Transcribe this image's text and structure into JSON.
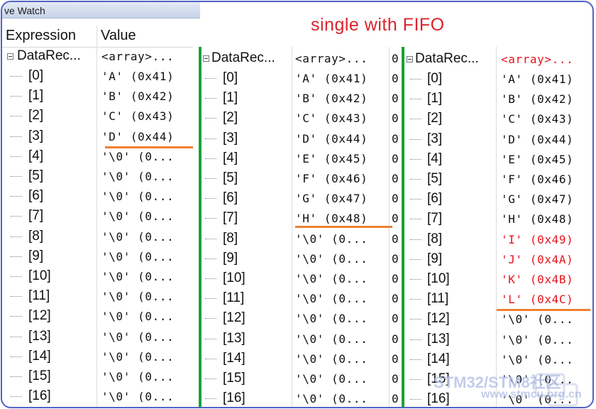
{
  "window": {
    "title": "ve Watch"
  },
  "headers": {
    "expression": "Expression",
    "value": "Value"
  },
  "annotation": "single with FIFO",
  "watermark": {
    "text": "STM32/STM8社区",
    "url": "www.stmcu.org.cn"
  },
  "colors": {
    "separator": "#19a33a",
    "underline": "#f08030",
    "changed_value": "#e8131b",
    "frame": "#4f63c6"
  },
  "panels": [
    {
      "root": {
        "name": "DataRec...",
        "value": "<array>..."
      },
      "rows": [
        {
          "index": "[0]",
          "value": "'A'  (0x41)"
        },
        {
          "index": "[1]",
          "value": "'B'  (0x42)"
        },
        {
          "index": "[2]",
          "value": "'C'  (0x43)"
        },
        {
          "index": "[3]",
          "value": "'D'  (0x44)"
        },
        {
          "index": "[4]",
          "value": "'\\0'  (0..."
        },
        {
          "index": "[5]",
          "value": "'\\0'  (0..."
        },
        {
          "index": "[6]",
          "value": "'\\0'  (0..."
        },
        {
          "index": "[7]",
          "value": "'\\0'  (0..."
        },
        {
          "index": "[8]",
          "value": "'\\0'  (0..."
        },
        {
          "index": "[9]",
          "value": "'\\0'  (0..."
        },
        {
          "index": "[10]",
          "value": "'\\0'  (0..."
        },
        {
          "index": "[11]",
          "value": "'\\0'  (0..."
        },
        {
          "index": "[12]",
          "value": "'\\0'  (0..."
        },
        {
          "index": "[13]",
          "value": "'\\0'  (0..."
        },
        {
          "index": "[14]",
          "value": "'\\0'  (0..."
        },
        {
          "index": "[15]",
          "value": "'\\0'  (0..."
        },
        {
          "index": "[16]",
          "value": "'\\0'  (0..."
        }
      ]
    },
    {
      "root": {
        "name": "DataRec...",
        "value": "<array>...",
        "extra": "0"
      },
      "rows": [
        {
          "index": "[0]",
          "value": "'A'  (0x41)",
          "extra": "0"
        },
        {
          "index": "[1]",
          "value": "'B'  (0x42)",
          "extra": "0"
        },
        {
          "index": "[2]",
          "value": "'C'  (0x43)",
          "extra": "0"
        },
        {
          "index": "[3]",
          "value": "'D'  (0x44)",
          "extra": "0"
        },
        {
          "index": "[4]",
          "value": "'E'  (0x45)",
          "extra": "0"
        },
        {
          "index": "[5]",
          "value": "'F'  (0x46)",
          "extra": "0"
        },
        {
          "index": "[6]",
          "value": "'G'  (0x47)",
          "extra": "0"
        },
        {
          "index": "[7]",
          "value": "'H'  (0x48)",
          "extra": "0"
        },
        {
          "index": "[8]",
          "value": "'\\0'  (0...",
          "extra": "0"
        },
        {
          "index": "[9]",
          "value": "'\\0'  (0...",
          "extra": "0"
        },
        {
          "index": "[10]",
          "value": "'\\0'  (0...",
          "extra": "0"
        },
        {
          "index": "[11]",
          "value": "'\\0'  (0...",
          "extra": "0"
        },
        {
          "index": "[12]",
          "value": "'\\0'  (0...",
          "extra": "0"
        },
        {
          "index": "[13]",
          "value": "'\\0'  (0...",
          "extra": "0"
        },
        {
          "index": "[14]",
          "value": "'\\0'  (0...",
          "extra": "0"
        },
        {
          "index": "[15]",
          "value": "'\\0'  (0...",
          "extra": "0"
        },
        {
          "index": "[16]",
          "value": "'\\0'  (0...",
          "extra": "0"
        }
      ]
    },
    {
      "root": {
        "name": "DataRec...",
        "value": "<array>...",
        "changed": true
      },
      "rows": [
        {
          "index": "[0]",
          "value": "'A'  (0x41)"
        },
        {
          "index": "[1]",
          "value": "'B'  (0x42)"
        },
        {
          "index": "[2]",
          "value": "'C'  (0x43)"
        },
        {
          "index": "[3]",
          "value": "'D'  (0x44)"
        },
        {
          "index": "[4]",
          "value": "'E'  (0x45)"
        },
        {
          "index": "[5]",
          "value": "'F'  (0x46)"
        },
        {
          "index": "[6]",
          "value": "'G'  (0x47)"
        },
        {
          "index": "[7]",
          "value": "'H'  (0x48)"
        },
        {
          "index": "[8]",
          "value": "'I'  (0x49)",
          "changed": true
        },
        {
          "index": "[9]",
          "value": "'J'  (0x4A)",
          "changed": true
        },
        {
          "index": "[10]",
          "value": "'K'  (0x4B)",
          "changed": true
        },
        {
          "index": "[11]",
          "value": "'L'  (0x4C)",
          "changed": true
        },
        {
          "index": "[12]",
          "value": "'\\0'  (0..."
        },
        {
          "index": "[13]",
          "value": "'\\0'  (0..."
        },
        {
          "index": "[14]",
          "value": "'\\0'  (0..."
        },
        {
          "index": "[15]",
          "value": "'\\0'  (0..."
        },
        {
          "index": "[16]",
          "value": "'\\0'  (0..."
        }
      ]
    }
  ]
}
